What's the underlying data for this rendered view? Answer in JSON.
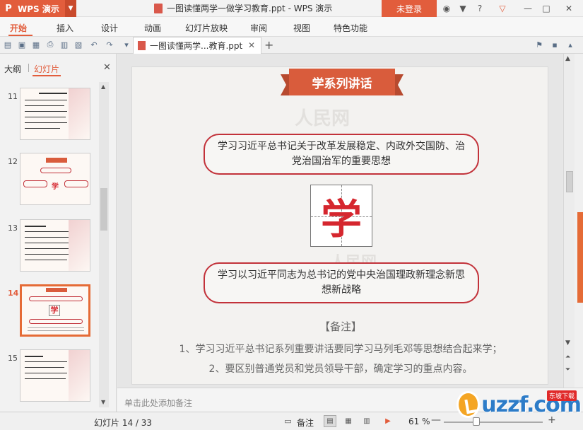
{
  "app": {
    "name": "WPS 演示",
    "window_title": "一图读懂两学一做学习教育.ppt - WPS 演示",
    "login_label": "未登录",
    "help_label": "?"
  },
  "menu": {
    "items": [
      "开始",
      "插入",
      "设计",
      "动画",
      "幻灯片放映",
      "审阅",
      "视图",
      "特色功能"
    ]
  },
  "tabs": {
    "doc_tab_label": "一图读懂两学...教育.ppt",
    "close_glyph": "✕",
    "new_tab_glyph": "+"
  },
  "left_panel": {
    "tab_outline": "大纲",
    "tab_slides": "幻灯片",
    "close_glyph": "✕",
    "thumbnails": [
      {
        "number": "11",
        "active": false
      },
      {
        "number": "12",
        "active": false
      },
      {
        "number": "13",
        "active": false
      },
      {
        "number": "14",
        "active": true
      },
      {
        "number": "15",
        "active": false
      }
    ]
  },
  "slide": {
    "banner_title": "学系列讲话",
    "watermark_text": "人民网",
    "bubble_1": "学习习近平总书记关于改革发展稳定、内政外交国防、治党治国治军的重要思想",
    "bubble_2": "学习以习近平同志为总书记的党中央治国理政新理念新思想新战略",
    "character": "学",
    "notes_heading": "【备注】",
    "note_1": "1、学习习近平总书记系列重要讲话要同学习马列毛邓等思想结合起来学；",
    "note_2": "2、要区别普通党员和党员领导干部，确定学习的重点内容。"
  },
  "notes_area": {
    "placeholder": "单击此处添加备注"
  },
  "status": {
    "slide_counter": "幻灯片 14 / 33",
    "notes_label": "备注",
    "zoom": "61 %",
    "zoom_minus": "—",
    "zoom_plus": "+"
  },
  "watermark_logo": {
    "text": "uzzf.com",
    "tag": "东坡下载"
  },
  "colors": {
    "accent": "#e25d3c",
    "slide_red": "#c2323a",
    "character_red": "#d5262e"
  }
}
